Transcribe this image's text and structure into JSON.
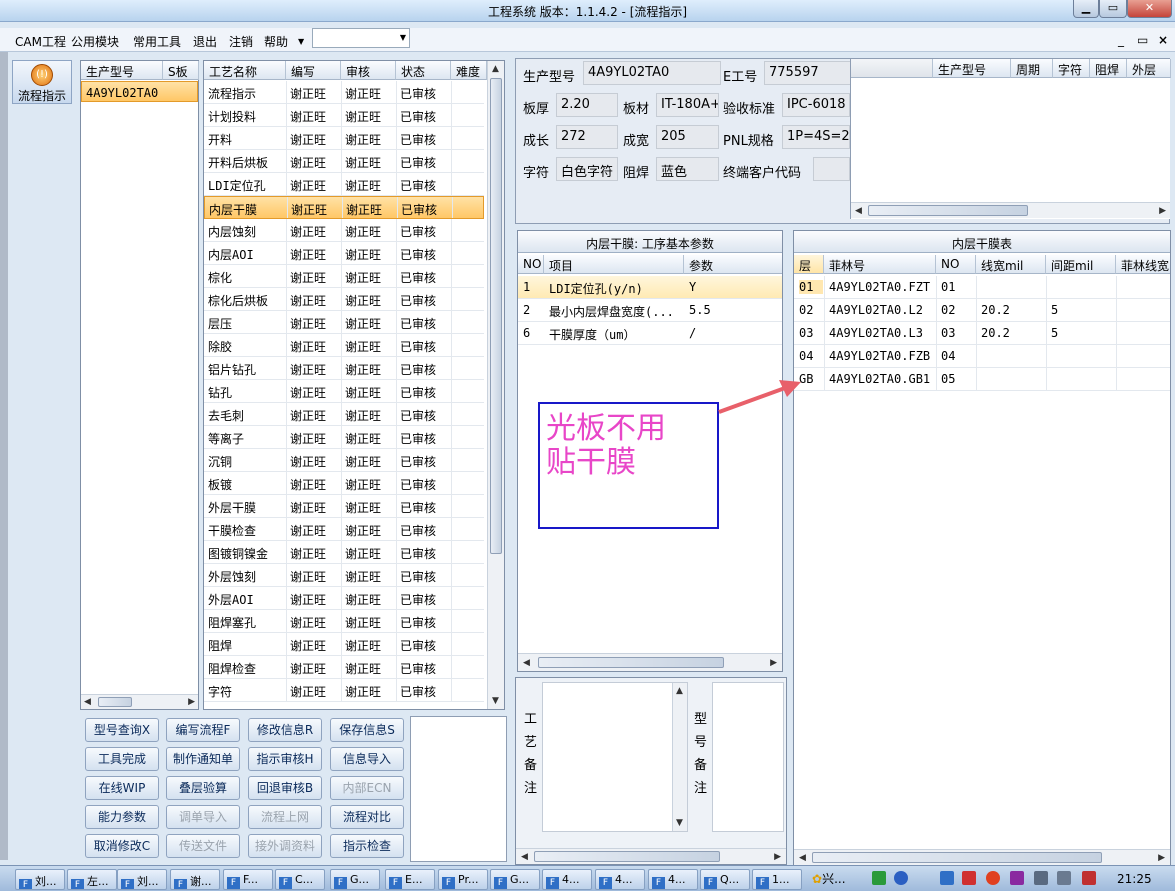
{
  "window": {
    "title": "工程系统   版本：1.1.4.2 - [流程指示]"
  },
  "menu": [
    "CAM工程",
    "公用模块",
    "常用工具",
    "退出",
    "注销",
    "帮助"
  ],
  "mdi_controls": [
    "_",
    "▭",
    "×"
  ],
  "left_nav": {
    "label": "流程指示"
  },
  "model_list": {
    "headers": [
      "生产型号",
      "S板"
    ],
    "rows": [
      [
        "4A9YL02TA0",
        ""
      ]
    ]
  },
  "process_list": {
    "headers": [
      "工艺名称",
      "编写",
      "审核",
      "状态",
      "难度"
    ],
    "rows": [
      [
        "流程指示",
        "谢正旺",
        "谢正旺",
        "已审核",
        ""
      ],
      [
        "计划投料",
        "谢正旺",
        "谢正旺",
        "已审核",
        ""
      ],
      [
        "开料",
        "谢正旺",
        "谢正旺",
        "已审核",
        ""
      ],
      [
        "开料后烘板",
        "谢正旺",
        "谢正旺",
        "已审核",
        ""
      ],
      [
        "LDI定位孔",
        "谢正旺",
        "谢正旺",
        "已审核",
        ""
      ],
      [
        "内层干膜",
        "谢正旺",
        "谢正旺",
        "已审核",
        ""
      ],
      [
        "内层蚀刻",
        "谢正旺",
        "谢正旺",
        "已审核",
        ""
      ],
      [
        "内层AOI",
        "谢正旺",
        "谢正旺",
        "已审核",
        ""
      ],
      [
        "棕化",
        "谢正旺",
        "谢正旺",
        "已审核",
        ""
      ],
      [
        "棕化后烘板",
        "谢正旺",
        "谢正旺",
        "已审核",
        ""
      ],
      [
        "层压",
        "谢正旺",
        "谢正旺",
        "已审核",
        ""
      ],
      [
        "除胶",
        "谢正旺",
        "谢正旺",
        "已审核",
        ""
      ],
      [
        "铝片钻孔",
        "谢正旺",
        "谢正旺",
        "已审核",
        ""
      ],
      [
        "钻孔",
        "谢正旺",
        "谢正旺",
        "已审核",
        ""
      ],
      [
        "去毛刺",
        "谢正旺",
        "谢正旺",
        "已审核",
        ""
      ],
      [
        "等离子",
        "谢正旺",
        "谢正旺",
        "已审核",
        ""
      ],
      [
        "沉铜",
        "谢正旺",
        "谢正旺",
        "已审核",
        ""
      ],
      [
        "板镀",
        "谢正旺",
        "谢正旺",
        "已审核",
        ""
      ],
      [
        "外层干膜",
        "谢正旺",
        "谢正旺",
        "已审核",
        ""
      ],
      [
        "干膜检查",
        "谢正旺",
        "谢正旺",
        "已审核",
        ""
      ],
      [
        "图镀铜镍金",
        "谢正旺",
        "谢正旺",
        "已审核",
        ""
      ],
      [
        "外层蚀刻",
        "谢正旺",
        "谢正旺",
        "已审核",
        ""
      ],
      [
        "外层AOI",
        "谢正旺",
        "谢正旺",
        "已审核",
        ""
      ],
      [
        "阻焊塞孔",
        "谢正旺",
        "谢正旺",
        "已审核",
        ""
      ],
      [
        "阻焊",
        "谢正旺",
        "谢正旺",
        "已审核",
        ""
      ],
      [
        "阻焊检查",
        "谢正旺",
        "谢正旺",
        "已审核",
        ""
      ],
      [
        "字符",
        "谢正旺",
        "谢正旺",
        "已审核",
        ""
      ]
    ],
    "selected_index": 5
  },
  "buttons": [
    [
      "型号查询X",
      "编写流程F",
      "修改信息R",
      "保存信息S"
    ],
    [
      "工具完成",
      "制作通知单",
      "指示审核H",
      "信息导入"
    ],
    [
      "在线WIP",
      "叠层验算",
      "回退审核B",
      "内部ECN"
    ],
    [
      "能力参数",
      "调单导入",
      "流程上网",
      "流程对比"
    ],
    [
      "取消修改C",
      "传送文件",
      "接外调资料",
      "指示检查"
    ]
  ],
  "info": {
    "model_label": "生产型号",
    "model_value": "4A9YL02TA0",
    "e_label": "E工号",
    "e_value": "775597",
    "thickness_label": "板厚",
    "thickness_value": "2.20",
    "material_label": "板材",
    "material_value": "IT-180A+",
    "standard_label": "验收标准",
    "standard_value": "IPC-6018",
    "length_label": "成长",
    "length_value": "272",
    "width_label": "成宽",
    "width_value": "205",
    "pnl_label": "PNL规格",
    "pnl_value": "1P=4S=2(",
    "silk_label": "字符",
    "silk_value": "白色字符",
    "mask_label": "阻焊",
    "mask_value": "蓝色",
    "cust_label": "终端客户代码",
    "cust_value": ""
  },
  "mini_grid": {
    "headers": [
      "生产型号",
      "周期",
      "字符",
      "阻焊",
      "外层"
    ]
  },
  "params_panel": {
    "title": "内层干膜: 工序基本参数",
    "headers": [
      "NO",
      "项目",
      "参数"
    ],
    "rows": [
      [
        "1",
        "LDI定位孔(y/n)",
        "Y"
      ],
      [
        "2",
        "最小内层焊盘宽度(...",
        "5.5"
      ],
      [
        "6",
        "干膜厚度（um）",
        "/"
      ]
    ]
  },
  "film_panel": {
    "title": "内层干膜表",
    "headers": [
      "层",
      "菲林号",
      "NO",
      "线宽mil",
      "间距mil",
      "菲林线宽"
    ],
    "rows": [
      [
        "01",
        "4A9YL02TA0.FZT",
        "01",
        "",
        "",
        ""
      ],
      [
        "02",
        "4A9YL02TA0.L2",
        "02",
        "20.2",
        "5",
        ""
      ],
      [
        "03",
        "4A9YL02TA0.L3",
        "03",
        "20.2",
        "5",
        ""
      ],
      [
        "04",
        "4A9YL02TA0.FZB",
        "04",
        "",
        "",
        ""
      ],
      [
        "GB",
        "4A9YL02TA0.GB1",
        "05",
        "",
        "",
        ""
      ]
    ]
  },
  "callout": {
    "text_line1": "光板不用",
    "text_line2": "贴干膜"
  },
  "remarks": {
    "process_label": "工艺备注",
    "model_label": "型号备注"
  },
  "taskbar": {
    "tasks": [
      "刘...",
      "左...",
      "刘...",
      "谢...",
      "F...",
      "C...",
      "G...",
      "E...",
      "Pr...",
      "G...",
      "4...",
      "4...",
      "4...",
      "Q...",
      "1..."
    ],
    "start_label": "兴...",
    "clock": "21:25"
  },
  "colors": {
    "selection": "#ffc766",
    "callout_text": "#e846c8",
    "callout_border": "#1818c8",
    "arrow": "#e8606a"
  }
}
